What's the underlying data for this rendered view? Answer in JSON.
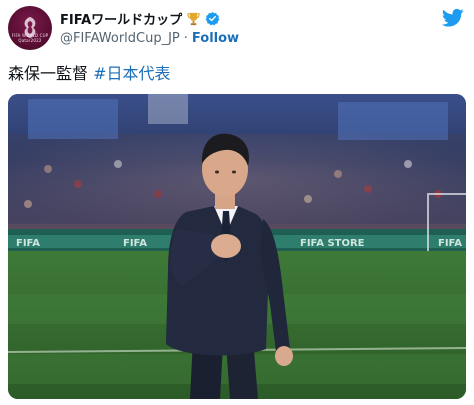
{
  "account": {
    "display_name": "FIFAワールドカップ",
    "handle": "@FIFAWorldCup_JP",
    "separator": "·",
    "follow_label": "Follow",
    "avatar_caption": "FIFA WORLD CUP Qatar2022"
  },
  "tweet": {
    "text": "森保一監督",
    "hashtag": "#日本代表"
  },
  "photo": {
    "board_left": "FIFA",
    "board_mid": "FIFA",
    "board_right": "FIFA STORE",
    "board_far_right": "FIFA"
  },
  "colors": {
    "link": "#1d6fb8",
    "verified": "#1d9bf0",
    "twitter_brand": "#1d9bf0",
    "avatar_bg": "#5a0e33"
  },
  "icons": {
    "trophy": "trophy-icon",
    "verified": "verified-badge-icon",
    "brand": "twitter-bird-icon"
  }
}
